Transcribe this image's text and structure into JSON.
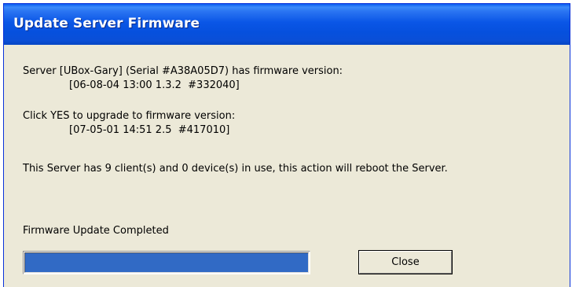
{
  "window": {
    "title": "Update Server Firmware"
  },
  "body": {
    "current_line": "Server [UBox-Gary] (Serial #A38A05D7) has firmware version:",
    "current_version": "[06-08-04 13:00 1.3.2  #332040]",
    "prompt_line": "Click YES to upgrade to firmware version:",
    "new_version": "[07-05-01 14:51 2.5  #417010]",
    "warning": "This Server has 9 client(s) and 0 device(s) in use, this action will reboot the Server.",
    "status": "Firmware Update Completed"
  },
  "progress": {
    "percent": 100,
    "color": "#316ac5"
  },
  "buttons": {
    "close_label": "Close"
  },
  "colors": {
    "titlebar": "#0650dd",
    "dialog_bg": "#ece9d8"
  }
}
